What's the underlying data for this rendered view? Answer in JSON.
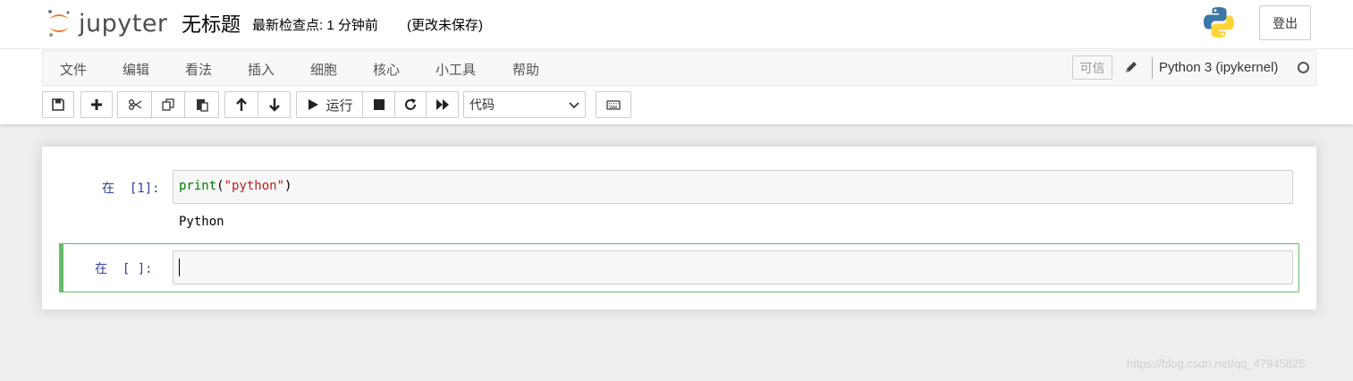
{
  "header": {
    "logo_text": "jupyter",
    "notebook_name": "无标题",
    "checkpoint": "最新检查点: 1 分钟前",
    "autosave_status": "(更改未保存)",
    "logout_label": "登出"
  },
  "menubar": {
    "items": [
      "文件",
      "编辑",
      "看法",
      "插入",
      "细胞",
      "核心",
      "小工具",
      "帮助"
    ],
    "trusted_label": "可信",
    "kernel_name": "Python 3 (ipykernel)"
  },
  "toolbar": {
    "run_label": "运行",
    "cell_type": "代码",
    "icons": [
      "save-icon",
      "plus-icon",
      "cut-icon",
      "copy-icon",
      "paste-icon",
      "arrow-up-icon",
      "arrow-down-icon",
      "play-icon",
      "stop-icon",
      "restart-icon",
      "fast-forward-icon",
      "keyboard-icon"
    ]
  },
  "cells": [
    {
      "prompt": "在  [1]:",
      "code_fn": "print",
      "code_open": "(",
      "code_str": "\"python\"",
      "code_close": ")",
      "output": "Python"
    },
    {
      "prompt": "在  [ ]:",
      "code": ""
    }
  ],
  "colors": {
    "prompt": "#303f9f",
    "selected_cell": "#66bb6a",
    "keyword": "#008000",
    "string": "#ba2121"
  },
  "watermark": "https://blog.csdn.net/qq_47945825"
}
